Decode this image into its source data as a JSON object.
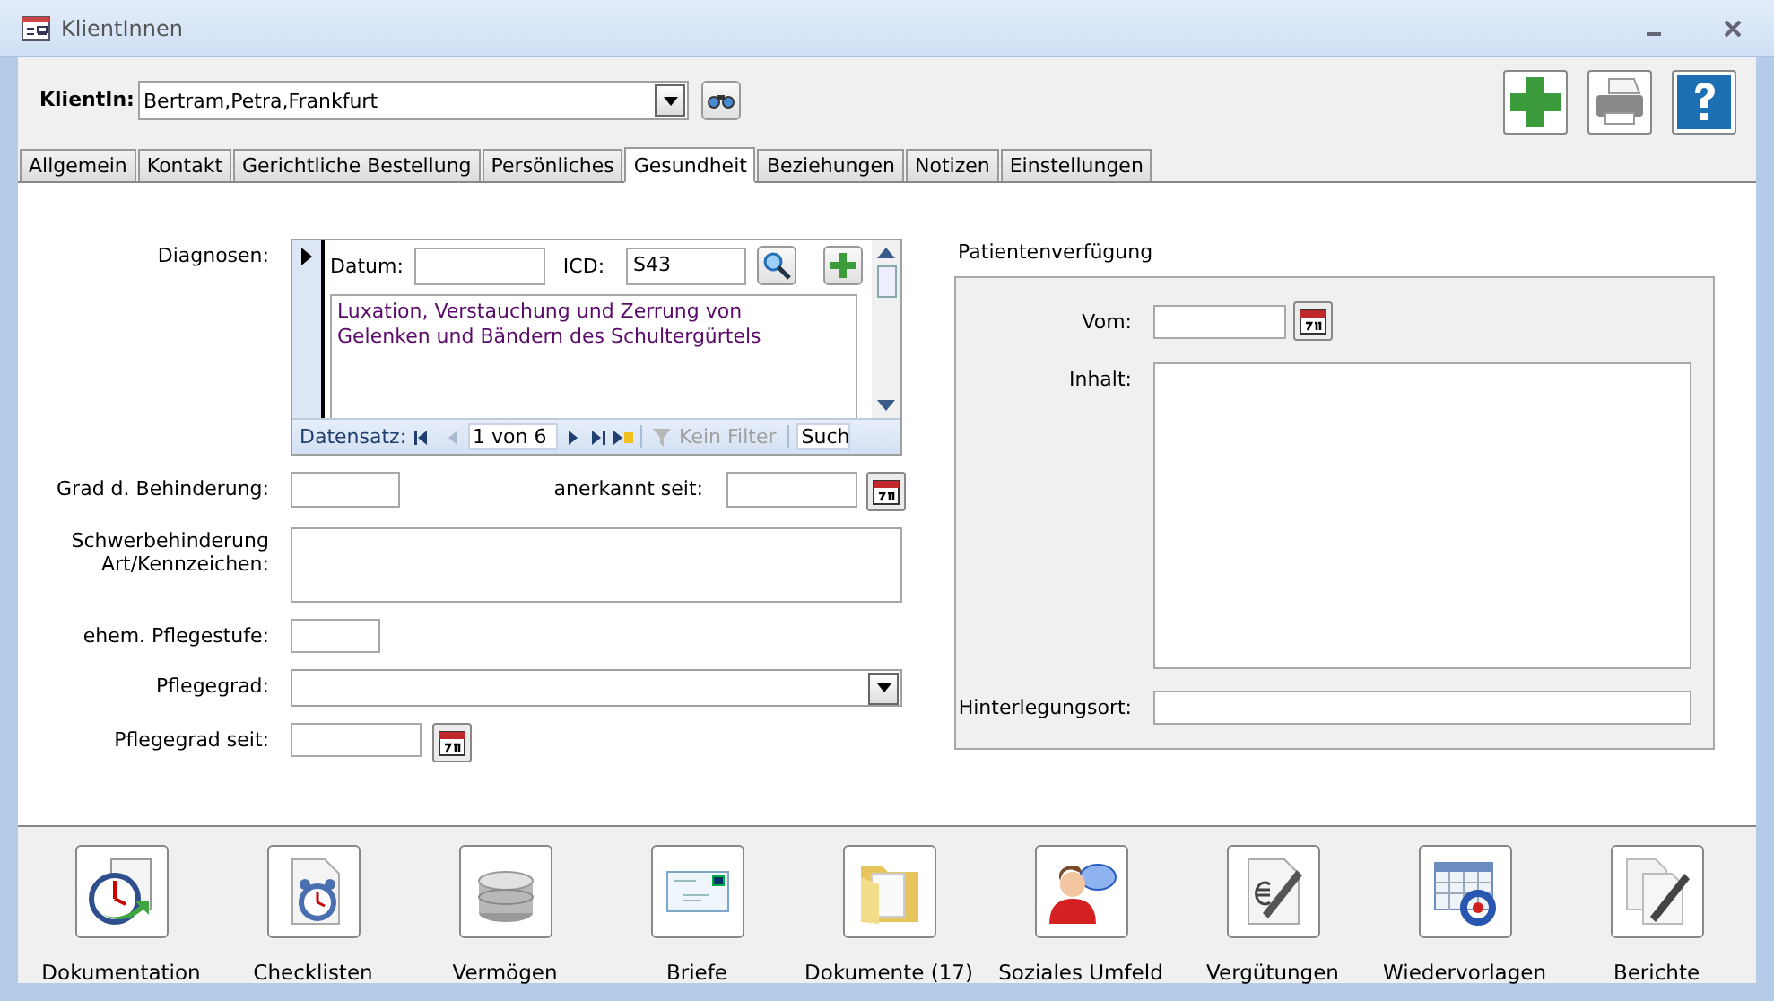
{
  "window": {
    "title": "KlientInnen"
  },
  "client": {
    "label": "KlientIn:",
    "value": "Bertram,Petra,Frankfurt"
  },
  "toolbar": [
    {
      "kind": "add"
    },
    {
      "kind": "print"
    },
    {
      "kind": "help"
    }
  ],
  "tabs": [
    {
      "label": "Allgemein",
      "selected": false
    },
    {
      "label": "Kontakt",
      "selected": false
    },
    {
      "label": "Gerichtliche Bestellung",
      "selected": false
    },
    {
      "label": "Persönliches",
      "selected": false
    },
    {
      "label": "Gesundheit",
      "selected": true
    },
    {
      "label": "Beziehungen",
      "selected": false
    },
    {
      "label": "Notizen",
      "selected": false
    },
    {
      "label": "Einstellungen",
      "selected": false
    }
  ],
  "diagnoses": {
    "label": "Diagnosen:",
    "date_label": "Datum:",
    "icd_label": "ICD:",
    "icd": "S43",
    "text": "Luxation, Verstauchung und Zerrung von\nGelenken und Bändern des Schultergürtels",
    "navigator": {
      "label": "Datensatz:",
      "position": "1 von 6",
      "filter": "Kein Filter",
      "filter_disabled": true,
      "search": "Such"
    }
  },
  "disability": {
    "degree_label": "Grad d. Behinderung:",
    "recognized_label": "anerkannt seit:",
    "severe_label": "Schwerbehinderung\nArt/Kennzeichen:"
  },
  "care": {
    "former_level_label": "ehem. Pflegestufe:",
    "grade_label": "Pflegegrad:",
    "grade_since_label": "Pflegegrad seit:"
  },
  "living_will": {
    "title": "Patientenverfügung",
    "from_label": "Vom:",
    "content_label": "Inhalt:",
    "location_label": "Hinterlegungsort:"
  },
  "shortcuts": [
    {
      "label": "Dokumentation",
      "kind": "clock"
    },
    {
      "label": "Checklisten",
      "kind": "alarm"
    },
    {
      "label": "Vermögen",
      "kind": "coins"
    },
    {
      "label": "Briefe",
      "kind": "letter"
    },
    {
      "label": "Dokumente (17)",
      "kind": "folder"
    },
    {
      "label": "Soziales Umfeld",
      "kind": "person"
    },
    {
      "label": "Vergütungen",
      "kind": "euro"
    },
    {
      "label": "Wiedervorlagen",
      "kind": "calendar"
    },
    {
      "label": "Berichte",
      "kind": "pen"
    }
  ]
}
